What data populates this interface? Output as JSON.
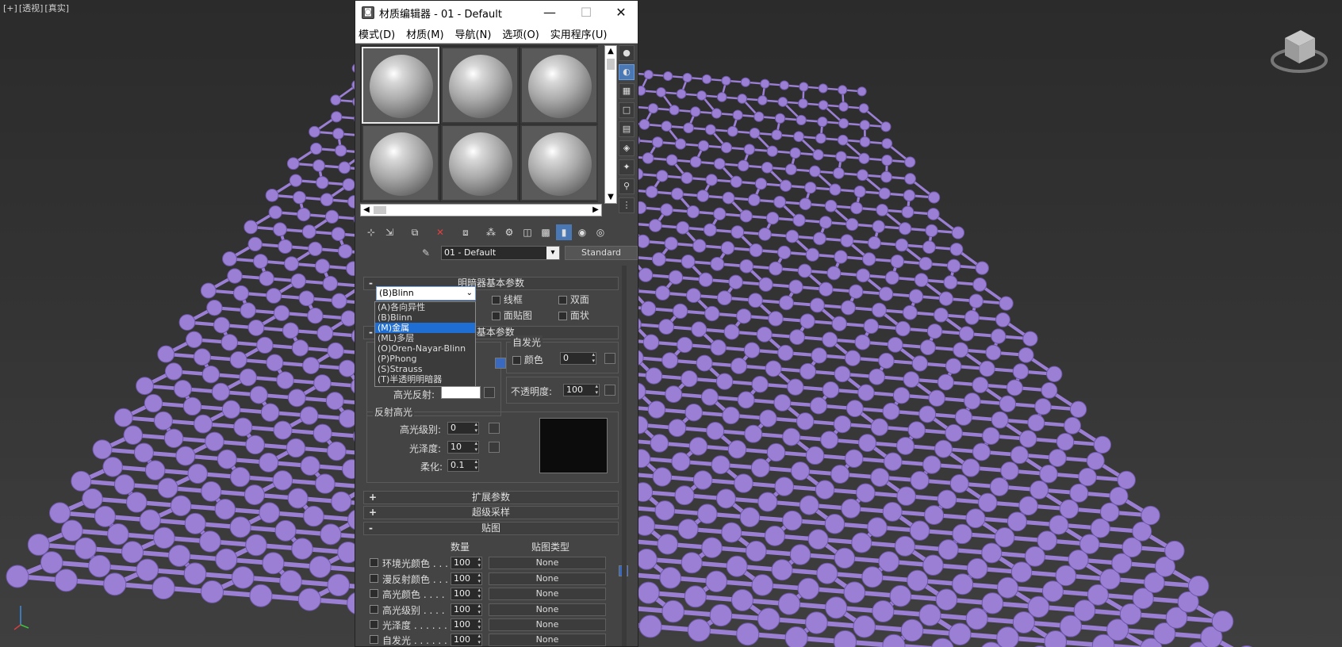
{
  "viewport": {
    "label_parts": [
      "[+]",
      "[透视]",
      "[真实]"
    ],
    "molecule_color": "#9b7fd4"
  },
  "window": {
    "title": "材质编辑器 - 01 - Default",
    "app_icon": "material-editor-icon",
    "min": "—",
    "max": "☐",
    "close": "✕"
  },
  "menu": [
    "模式(D)",
    "材质(M)",
    "导航(N)",
    "选项(O)",
    "实用程序(U)"
  ],
  "material": {
    "name": "01 - Default",
    "type": "Standard"
  },
  "shader_basic": {
    "title": "明暗器基本参数",
    "selected": "(B)Blinn",
    "options": [
      "(A)各向异性",
      "(B)Blinn",
      "(M)金属",
      "(ML)多层",
      "(O)Oren-Nayar-Blinn",
      "(P)Phong",
      "(S)Strauss",
      "(T)半透明明暗器"
    ],
    "highlighted": "(M)金属",
    "wire": "线框",
    "two_sided": "双面",
    "face_map": "面贴图",
    "faceted": "面状"
  },
  "blinn_basic": {
    "title_tail": "n 基本参数",
    "self_illum": "自发光",
    "color_label": "颜色",
    "color_value": "0",
    "specular_label": "高光反射:",
    "opacity_label": "不透明度:",
    "opacity_value": "100"
  },
  "spec_highlights": {
    "title": "反射高光",
    "level_label": "高光级别:",
    "level_value": "0",
    "gloss_label": "光泽度:",
    "gloss_value": "10",
    "soften_label": "柔化:",
    "soften_value": "0.1"
  },
  "extended": {
    "title": "扩展参数"
  },
  "supersampling": {
    "title": "超级采样"
  },
  "maps": {
    "title": "贴图",
    "col_amount": "数量",
    "col_type": "贴图类型",
    "rows": [
      {
        "label": "环境光颜色 . . .",
        "amount": "100",
        "map": "None"
      },
      {
        "label": "漫反射颜色 . . .",
        "amount": "100",
        "map": "None"
      },
      {
        "label": "高光颜色  . . . .",
        "amount": "100",
        "map": "None"
      },
      {
        "label": "高光级别  . . . .",
        "amount": "100",
        "map": "None"
      },
      {
        "label": "光泽度 . . . . . .",
        "amount": "100",
        "map": "None"
      },
      {
        "label": "自发光 . . . . . .",
        "amount": "100",
        "map": "None"
      }
    ]
  }
}
